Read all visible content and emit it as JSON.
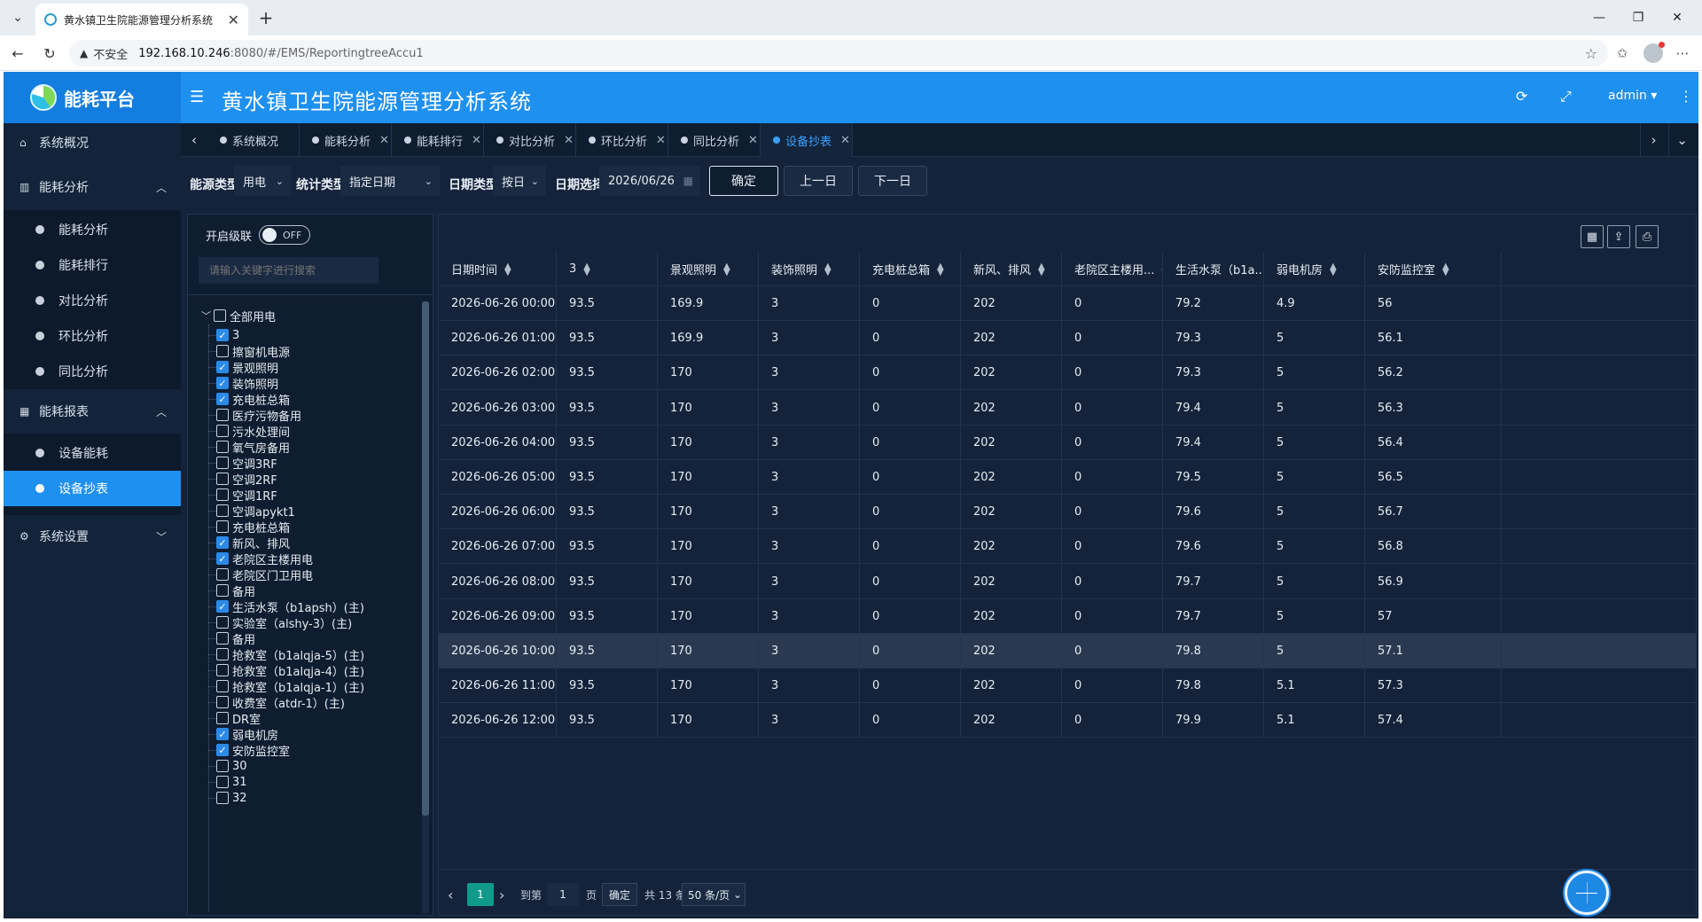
{
  "browser": {
    "tab_title": "黄水镇卫生院能源管理分析系统",
    "insecure_label": "不安全",
    "url_host": "192.168.10.246",
    "url_path": ":8080/#/EMS/ReportingtreeAccu1"
  },
  "header": {
    "logo_text": "能耗平台",
    "system_title": "黄水镇卫生院能源管理分析系统",
    "user": "admin"
  },
  "sidebar": {
    "groups": [
      {
        "label": "系统概况"
      },
      {
        "label": "能耗分析",
        "items": [
          "能耗分析",
          "能耗排行",
          "对比分析",
          "环比分析",
          "同比分析"
        ]
      },
      {
        "label": "能耗报表",
        "items": [
          "设备能耗",
          "设备抄表"
        ]
      },
      {
        "label": "系统设置"
      }
    ],
    "active_item": "设备抄表"
  },
  "page_tabs": [
    "系统概况",
    "能耗分析",
    "能耗排行",
    "对比分析",
    "环比分析",
    "同比分析",
    "设备抄表"
  ],
  "filters": {
    "energy_type_label": "能源类型",
    "energy_type_value": "用电",
    "stat_type_label": "统计类型",
    "stat_type_value": "指定日期",
    "date_type_label": "日期类型",
    "date_type_value": "按日",
    "date_select_label": "日期选择",
    "date_value": "2026/06/26",
    "confirm": "确定",
    "prev_day": "上一日",
    "next_day": "下一日"
  },
  "tree": {
    "cascade_label": "开启级联",
    "cascade_state": "OFF",
    "search_placeholder": "请输入关键字进行搜索",
    "root": "全部用电",
    "nodes": [
      {
        "label": "3",
        "checked": true
      },
      {
        "label": "擦窗机电源",
        "checked": false
      },
      {
        "label": "景观照明",
        "checked": true
      },
      {
        "label": "装饰照明",
        "checked": true
      },
      {
        "label": "充电桩总箱",
        "checked": true
      },
      {
        "label": "医疗污物备用",
        "checked": false
      },
      {
        "label": "污水处理间",
        "checked": false
      },
      {
        "label": "氧气房备用",
        "checked": false
      },
      {
        "label": "空调3RF",
        "checked": false
      },
      {
        "label": "空调2RF",
        "checked": false
      },
      {
        "label": "空调1RF",
        "checked": false
      },
      {
        "label": "空调apykt1",
        "checked": false
      },
      {
        "label": "充电桩总箱",
        "checked": false
      },
      {
        "label": "新风、排风",
        "checked": true
      },
      {
        "label": "老院区主楼用电",
        "checked": true
      },
      {
        "label": "老院区门卫用电",
        "checked": false
      },
      {
        "label": "备用",
        "checked": false
      },
      {
        "label": "生活水泵（b1apsh）(主)",
        "checked": true
      },
      {
        "label": "实验室（alshy-3）(主)",
        "checked": false
      },
      {
        "label": "备用",
        "checked": false
      },
      {
        "label": "抢救室（b1alqja-5）(主)",
        "checked": false
      },
      {
        "label": "抢救室（b1alqja-4）(主)",
        "checked": false
      },
      {
        "label": "抢救室（b1alqja-1）(主)",
        "checked": false
      },
      {
        "label": "收费室（atdr-1）(主)",
        "checked": false
      },
      {
        "label": "DR室",
        "checked": false
      },
      {
        "label": "弱电机房",
        "checked": true
      },
      {
        "label": "安防监控室",
        "checked": true
      },
      {
        "label": "30",
        "checked": false
      },
      {
        "label": "31",
        "checked": false
      },
      {
        "label": "32",
        "checked": false
      }
    ]
  },
  "table": {
    "columns": [
      "日期时间",
      "3",
      "景观照明",
      "装饰照明",
      "充电桩总箱",
      "新风、排风",
      "老院区主楼用...",
      "生活水泵（b1a...",
      "弱电机房",
      "安防监控室"
    ],
    "rows": [
      [
        "2026-06-26 00:00:00",
        "93.5",
        "169.9",
        "3",
        "0",
        "202",
        "0",
        "79.2",
        "4.9",
        "56"
      ],
      [
        "2026-06-26 01:00:00",
        "93.5",
        "169.9",
        "3",
        "0",
        "202",
        "0",
        "79.3",
        "5",
        "56.1"
      ],
      [
        "2026-06-26 02:00:00",
        "93.5",
        "170",
        "3",
        "0",
        "202",
        "0",
        "79.3",
        "5",
        "56.2"
      ],
      [
        "2026-06-26 03:00:00",
        "93.5",
        "170",
        "3",
        "0",
        "202",
        "0",
        "79.4",
        "5",
        "56.3"
      ],
      [
        "2026-06-26 04:00:00",
        "93.5",
        "170",
        "3",
        "0",
        "202",
        "0",
        "79.4",
        "5",
        "56.4"
      ],
      [
        "2026-06-26 05:00:00",
        "93.5",
        "170",
        "3",
        "0",
        "202",
        "0",
        "79.5",
        "5",
        "56.5"
      ],
      [
        "2026-06-26 06:00:00",
        "93.5",
        "170",
        "3",
        "0",
        "202",
        "0",
        "79.6",
        "5",
        "56.7"
      ],
      [
        "2026-06-26 07:00:00",
        "93.5",
        "170",
        "3",
        "0",
        "202",
        "0",
        "79.6",
        "5",
        "56.8"
      ],
      [
        "2026-06-26 08:00:00",
        "93.5",
        "170",
        "3",
        "0",
        "202",
        "0",
        "79.7",
        "5",
        "56.9"
      ],
      [
        "2026-06-26 09:00:00",
        "93.5",
        "170",
        "3",
        "0",
        "202",
        "0",
        "79.7",
        "5",
        "57"
      ],
      [
        "2026-06-26 10:00:00",
        "93.5",
        "170",
        "3",
        "0",
        "202",
        "0",
        "79.8",
        "5",
        "57.1"
      ],
      [
        "2026-06-26 11:00:00",
        "93.5",
        "170",
        "3",
        "0",
        "202",
        "0",
        "79.8",
        "5.1",
        "57.3"
      ],
      [
        "2026-06-26 12:00:00",
        "93.5",
        "170",
        "3",
        "0",
        "202",
        "0",
        "79.9",
        "5.1",
        "57.4"
      ]
    ],
    "highlighted_row": 10
  },
  "pager": {
    "current_page": "1",
    "goto_label": "到第",
    "goto_value": "1",
    "page_unit": "页",
    "confirm": "确定",
    "total": "共 13 条",
    "page_size": "50 条/页"
  }
}
